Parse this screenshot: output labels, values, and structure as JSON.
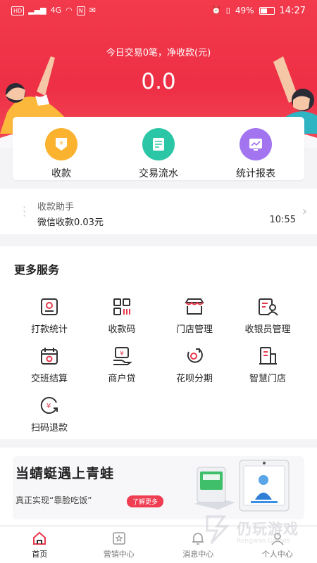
{
  "status_bar": {
    "left_indicators": [
      "HD",
      "4G",
      "N"
    ],
    "battery": "49%",
    "time": "14:27"
  },
  "summary": {
    "caption": "今日交易0笔，净收款(元)",
    "amount": "0.0"
  },
  "quick_actions": [
    {
      "label": "收款",
      "icon": "collect-money-icon",
      "color": "#fbb22e"
    },
    {
      "label": "交易流水",
      "icon": "transaction-list-icon",
      "color": "#2bc6a6"
    },
    {
      "label": "统计报表",
      "icon": "report-chart-icon",
      "color": "#a374f0"
    }
  ],
  "assistant": {
    "title": "收款助手",
    "message": "微信收款0.03元",
    "time": "10:55"
  },
  "services": {
    "title": "更多服务",
    "items": [
      {
        "label": "打款统计",
        "icon": "payment-stats-icon"
      },
      {
        "label": "收款码",
        "icon": "qr-code-icon"
      },
      {
        "label": "门店管理",
        "icon": "store-icon"
      },
      {
        "label": "收银员管理",
        "icon": "cashier-icon"
      },
      {
        "label": "交班结算",
        "icon": "shift-settlement-icon"
      },
      {
        "label": "商户贷",
        "icon": "merchant-loan-icon"
      },
      {
        "label": "花呗分期",
        "icon": "installment-icon"
      },
      {
        "label": "智慧门店",
        "icon": "smart-store-icon"
      },
      {
        "label": "扫码退款",
        "icon": "scan-refund-icon"
      }
    ]
  },
  "banner": {
    "title": "当蜻蜓遇上青蛙",
    "subtitle": "真正实现“靠脸吃饭”",
    "button": "了解更多"
  },
  "tabs": [
    {
      "label": "首页",
      "icon": "home-icon",
      "active": true
    },
    {
      "label": "营销中心",
      "icon": "marketing-icon",
      "active": false
    },
    {
      "label": "消息中心",
      "icon": "bell-icon",
      "active": false
    },
    {
      "label": "个人中心",
      "icon": "user-icon",
      "active": false
    }
  ],
  "watermark": {
    "text": "仍玩游戏",
    "sub": "Rengwan Games"
  },
  "colors": {
    "brand_red": "#ef3347",
    "accent_red": "#ef3d52"
  }
}
